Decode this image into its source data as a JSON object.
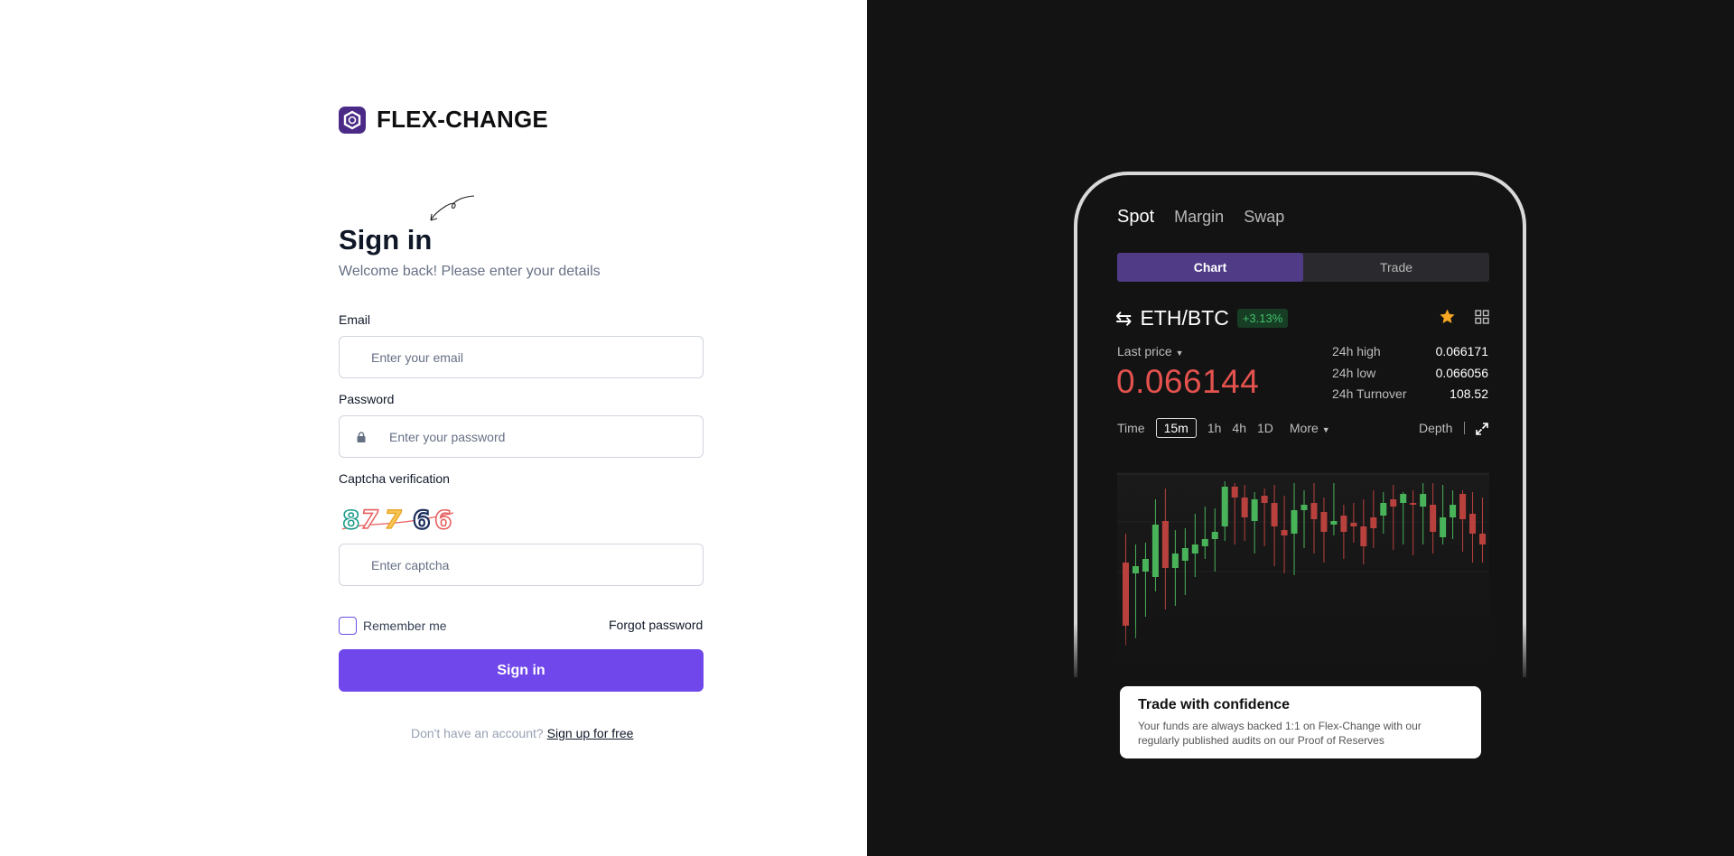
{
  "brand": {
    "name": "FLEX-CHANGE"
  },
  "signin": {
    "title": "Sign in",
    "subtitle": "Welcome back! Please enter your details",
    "email_label": "Email",
    "email_placeholder": "Enter your email",
    "password_label": "Password",
    "password_placeholder": "Enter your password",
    "captcha_label": "Captcha verification",
    "captcha_code": "87766",
    "captcha_placeholder": "Enter captcha",
    "remember_label": "Remember me",
    "forgot_label": "Forgot password",
    "button_label": "Sign in",
    "signup_question": "Don't have an account?",
    "signup_link": "Sign up for free"
  },
  "promo": {
    "tabs": [
      {
        "label": "Spot",
        "active": true
      },
      {
        "label": "Margin",
        "active": false
      },
      {
        "label": "Swap",
        "active": false
      }
    ],
    "segments": [
      {
        "label": "Chart",
        "active": true
      },
      {
        "label": "Trade",
        "active": false
      }
    ],
    "pair": "ETH/BTC",
    "change": "+3.13%",
    "last_price_label": "Last price",
    "last_price": "0.066144",
    "stats": [
      {
        "label": "24h high",
        "value": "0.066171"
      },
      {
        "label": "24h low",
        "value": "0.066056"
      },
      {
        "label": "24h Turnover",
        "value": "108.52"
      }
    ],
    "timeframes": {
      "time_label": "Time",
      "options": [
        "15m",
        "1h",
        "4h",
        "1D"
      ],
      "selected": "15m",
      "more_label": "More",
      "depth_label": "Depth"
    },
    "card": {
      "title": "Trade with confidence",
      "text": "Your funds are always backed 1:1 on Flex-Change with our regularly published audits on our Proof of Reserves"
    }
  },
  "colors": {
    "accent": "#7047ea",
    "up": "#3fc26a",
    "down": "#e4524e",
    "dark_bg": "#131313"
  },
  "candles": [
    {
      "o": 0.062,
      "c": 0.0585,
      "h": 0.0636,
      "l": 0.0574
    },
    {
      "o": 0.0614,
      "c": 0.0618,
      "h": 0.063,
      "l": 0.0578
    },
    {
      "o": 0.0615,
      "c": 0.0622,
      "h": 0.0631,
      "l": 0.059
    },
    {
      "o": 0.0612,
      "c": 0.0641,
      "h": 0.0655,
      "l": 0.0604
    },
    {
      "o": 0.0643,
      "c": 0.0617,
      "h": 0.0661,
      "l": 0.0594
    },
    {
      "o": 0.0617,
      "c": 0.0625,
      "h": 0.0638,
      "l": 0.0596
    },
    {
      "o": 0.0621,
      "c": 0.0628,
      "h": 0.0639,
      "l": 0.0602
    },
    {
      "o": 0.0625,
      "c": 0.063,
      "h": 0.0647,
      "l": 0.0612
    },
    {
      "o": 0.0629,
      "c": 0.0633,
      "h": 0.0651,
      "l": 0.0622
    },
    {
      "o": 0.0633,
      "c": 0.0637,
      "h": 0.065,
      "l": 0.0615
    },
    {
      "o": 0.064,
      "c": 0.0662,
      "h": 0.0665,
      "l": 0.0632
    },
    {
      "o": 0.0662,
      "c": 0.0656,
      "h": 0.0664,
      "l": 0.063
    },
    {
      "o": 0.0656,
      "c": 0.0645,
      "h": 0.0663,
      "l": 0.0632
    },
    {
      "o": 0.0643,
      "c": 0.0655,
      "h": 0.0659,
      "l": 0.0625
    },
    {
      "o": 0.0657,
      "c": 0.0653,
      "h": 0.0661,
      "l": 0.0629
    },
    {
      "o": 0.0653,
      "c": 0.064,
      "h": 0.0663,
      "l": 0.0618
    },
    {
      "o": 0.0638,
      "c": 0.0635,
      "h": 0.0657,
      "l": 0.0614
    },
    {
      "o": 0.0636,
      "c": 0.0649,
      "h": 0.0664,
      "l": 0.0613
    },
    {
      "o": 0.0649,
      "c": 0.0652,
      "h": 0.066,
      "l": 0.0628
    },
    {
      "o": 0.0653,
      "c": 0.0644,
      "h": 0.0664,
      "l": 0.0625
    },
    {
      "o": 0.0648,
      "c": 0.0637,
      "h": 0.0656,
      "l": 0.062
    },
    {
      "o": 0.0641,
      "c": 0.0643,
      "h": 0.0664,
      "l": 0.0635
    },
    {
      "o": 0.0646,
      "c": 0.0637,
      "h": 0.0652,
      "l": 0.0622
    },
    {
      "o": 0.0642,
      "c": 0.064,
      "h": 0.0653,
      "l": 0.0631
    },
    {
      "o": 0.064,
      "c": 0.0629,
      "h": 0.0655,
      "l": 0.0619
    },
    {
      "o": 0.0645,
      "c": 0.0639,
      "h": 0.066,
      "l": 0.0628
    },
    {
      "o": 0.0646,
      "c": 0.0653,
      "h": 0.0659,
      "l": 0.0636
    },
    {
      "o": 0.0655,
      "c": 0.0651,
      "h": 0.0663,
      "l": 0.0627
    },
    {
      "o": 0.0653,
      "c": 0.0658,
      "h": 0.0659,
      "l": 0.063
    },
    {
      "o": 0.0653,
      "c": 0.0652,
      "h": 0.066,
      "l": 0.0624
    },
    {
      "o": 0.0651,
      "c": 0.0658,
      "h": 0.0664,
      "l": 0.063
    },
    {
      "o": 0.0652,
      "c": 0.0637,
      "h": 0.0664,
      "l": 0.0625
    },
    {
      "o": 0.0634,
      "c": 0.0645,
      "h": 0.0663,
      "l": 0.063
    },
    {
      "o": 0.0645,
      "c": 0.0652,
      "h": 0.066,
      "l": 0.0633
    },
    {
      "o": 0.0658,
      "c": 0.0644,
      "h": 0.066,
      "l": 0.0626
    },
    {
      "o": 0.0647,
      "c": 0.0636,
      "h": 0.0659,
      "l": 0.062
    },
    {
      "o": 0.0636,
      "c": 0.063,
      "h": 0.0656,
      "l": 0.062
    }
  ]
}
